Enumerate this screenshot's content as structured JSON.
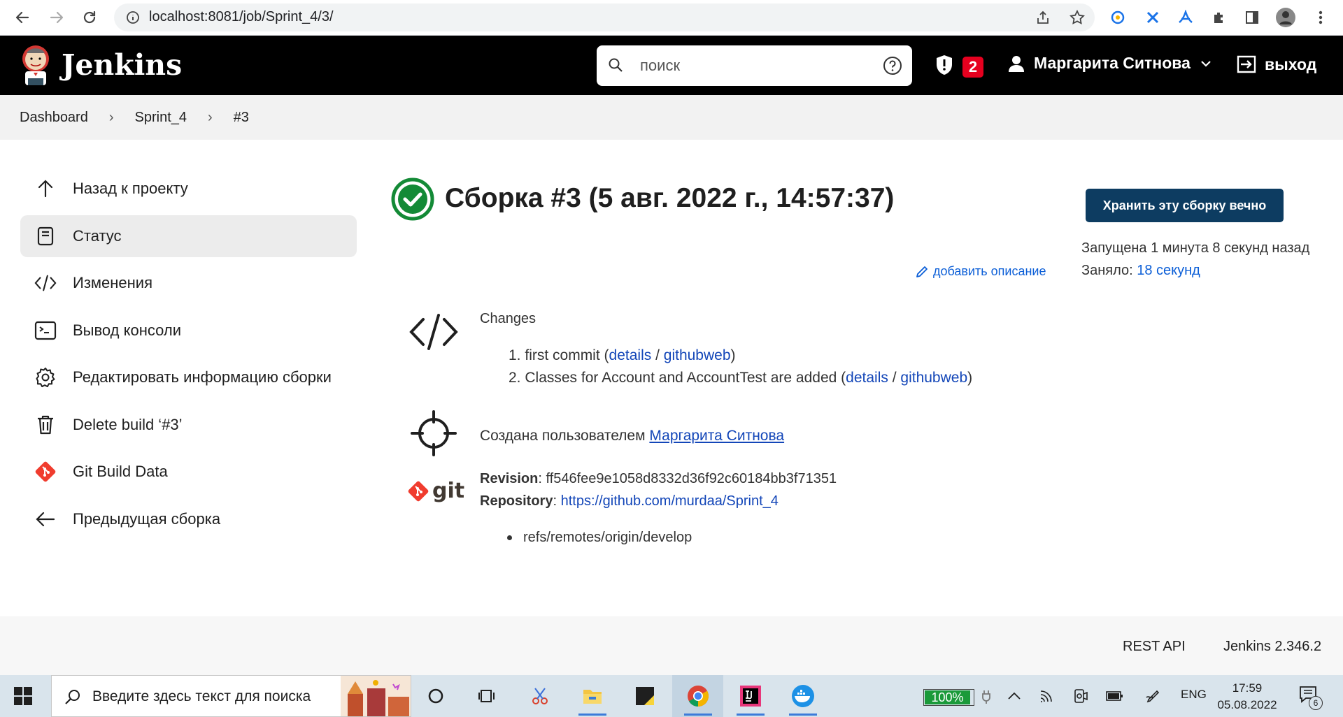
{
  "browser": {
    "url": "localhost:8081/job/Sprint_4/3/"
  },
  "header": {
    "logo_text": "Jenkins",
    "search_placeholder": "поиск",
    "security_badge_count": "2",
    "user_name": "Маргарита Ситнова",
    "logout_label": "выход"
  },
  "breadcrumb": {
    "items": [
      "Dashboard",
      "Sprint_4",
      "#3"
    ]
  },
  "sidebar": {
    "items": [
      {
        "label": "Назад к проекту",
        "icon": "arrow-up-icon"
      },
      {
        "label": "Статус",
        "icon": "document-icon"
      },
      {
        "label": "Изменения",
        "icon": "code-icon"
      },
      {
        "label": "Вывод консоли",
        "icon": "terminal-icon"
      },
      {
        "label": "Редактировать информацию сборки",
        "icon": "gear-icon"
      },
      {
        "label": "Delete build ‘#3’",
        "icon": "trash-icon"
      },
      {
        "label": "Git Build Data",
        "icon": "git-icon"
      },
      {
        "label": "Предыдущая сборка",
        "icon": "arrow-left-icon"
      }
    ]
  },
  "build": {
    "title": "Сборка #3 (5 авг. 2022 г., 14:57:37)",
    "keep_label": "Хранить эту сборку вечно",
    "started_ago": "Запущена 1 минута 8 секунд назад",
    "took_label": "Заняло:",
    "took_value": "18 секунд",
    "add_description": "добавить описание",
    "status_color": "#138a36"
  },
  "changes": {
    "heading": "Changes",
    "items": [
      {
        "num": "1.",
        "message": "first commit",
        "details": "details",
        "githubweb": "githubweb"
      },
      {
        "num": "2.",
        "message": "Classes for Account and AccountTest are added",
        "details": "details",
        "githubweb": "githubweb"
      }
    ]
  },
  "started_by": {
    "prefix": "Создана пользователем",
    "user": "Маргарита Ситнова"
  },
  "git": {
    "logo_text": "git",
    "revision_label": "Revision",
    "revision": "ff546fee9e1058d8332d36f92c60184bb3f71351",
    "repository_label": "Repository",
    "repository": "https://github.com/murdaa/Sprint_4",
    "branch": "refs/remotes/origin/develop"
  },
  "footer": {
    "rest_api": "REST API",
    "version": "Jenkins 2.346.2"
  },
  "taskbar": {
    "search_placeholder": "Введите здесь текст для поиска",
    "battery": "100%",
    "language": "ENG",
    "time": "17:59",
    "date": "05.08.2022",
    "notification_count": "6"
  },
  "colors": {
    "header_bg": "#000000",
    "accent_button": "#0d3c61",
    "link": "#1346b8",
    "badge": "#e6001f",
    "success": "#138a36"
  }
}
